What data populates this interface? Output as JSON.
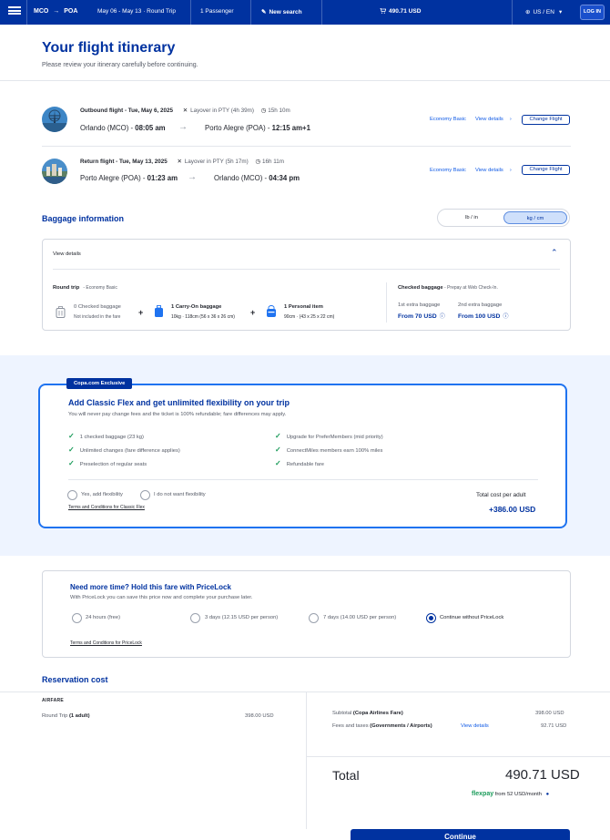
{
  "topbar": {
    "origin": "MCO",
    "destination": "POA",
    "dates": "May 06 - May 13 · Round Trip",
    "passengers": "1 Passenger",
    "new_search": "New search",
    "cart_total": "490.71 USD",
    "locale": "US / EN",
    "login": "LOG IN"
  },
  "page": {
    "title": "Your flight itinerary",
    "subtitle": "Please review your itinerary carefully before continuing."
  },
  "flights": [
    {
      "label": "Outbound flight - Tue, May 6, 2025",
      "layover": "Layover in PTY (4h 39m)",
      "duration": "15h 10m",
      "from_city": "Orlando (MCO)",
      "from_time": "08:05 am",
      "to_city": "Porto Alegre (POA)",
      "to_time": "12:15 am+1",
      "fare": "Economy Basic",
      "details": "View details",
      "change": "Change Flight"
    },
    {
      "label": "Return flight - Tue, May 13, 2025",
      "layover": "Layover in PTY (5h 17m)",
      "duration": "16h 11m",
      "from_city": "Porto Alegre (POA)",
      "from_time": "01:23 am",
      "to_city": "Orlando (MCO)",
      "to_time": "04:34 pm",
      "fare": "Economy Basic",
      "details": "View details",
      "change": "Change Flight"
    }
  ],
  "baggage": {
    "title": "Baggage information",
    "unit_imperial": "lb / in",
    "unit_metric": "kg / cm",
    "view_details": "View details",
    "trip_label": "Round trip",
    "trip_fare": "Economy Basic",
    "items": [
      {
        "title": "0 Checked baggage",
        "detail": "Not included in the fare"
      },
      {
        "title": "1 Carry-On baggage",
        "detail": "10kg · 118cm (56 x 36 x 26 cm)"
      },
      {
        "title": "1 Personal item",
        "detail": "90cm · (43 x 25 x 22 cm)"
      }
    ],
    "checked_title": "Checked baggage",
    "checked_note": "Prepay at Web Check-In.",
    "extra": [
      {
        "label": "1st extra baggage",
        "price": "From 70 USD"
      },
      {
        "label": "2nd extra baggage",
        "price": "From 100 USD"
      }
    ]
  },
  "flex": {
    "tag": "Copa.com Exclusive",
    "title": "Add Classic Flex and get unlimited flexibility on your trip",
    "subtitle": "You will never pay change fees and the ticket is 100% refundable; fare differences may apply.",
    "benefits_left": [
      "1 checked baggage (23 kg)",
      "Unlimited changes (fare difference applies)",
      "Preselection of regular seats"
    ],
    "benefits_right": [
      "Upgrade for PreferMembers (mid priority)",
      "ConnectMiles members earn 100% miles",
      "Refundable fare"
    ],
    "yes": "Yes, add flexibility",
    "no": "I do not want flexibility",
    "terms": "Terms and Conditions for Classic Flex",
    "cost_label": "Total cost per adult",
    "cost_value": "+386.00 USD"
  },
  "pricelock": {
    "title": "Need more time? Hold this fare with PriceLock",
    "subtitle": "With PriceLock you can save this price now and complete your purchase later.",
    "options": [
      "24 hours (free)",
      "3 days (12.15 USD per person)",
      "7 days (14.00 USD per person)",
      "Continue without PriceLock"
    ],
    "terms": "Terms and Conditions for PriceLock"
  },
  "reservation": {
    "title": "Reservation cost",
    "airfare_label": "AIRFARE",
    "trip_prefix": "Round Trip",
    "trip_paren": "(1 adult)",
    "trip_price": "398.00 USD",
    "subtotal_label": "Subtotal",
    "subtotal_paren": "(Copa Airlines Fare)",
    "subtotal_value": "398.00 USD",
    "fees_label": "Fees and taxes",
    "fees_paren": "(Governments / Airports)",
    "fees_link": "View details",
    "fees_value": "92.71 USD",
    "total_label": "Total",
    "total_value": "490.71 USD",
    "flexpay_brand": "flexpay",
    "flexpay_text": "from 52 USD/month",
    "continue": "Continue"
  },
  "colors": {
    "brand": "#0032a0",
    "link": "#0f5ae6",
    "check": "#1a9b5a",
    "band": "#eef4ff"
  }
}
